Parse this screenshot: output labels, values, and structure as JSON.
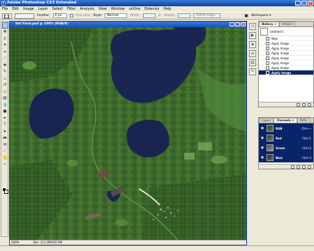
{
  "app": {
    "title": "Adobe Photoshop CS3 Extended",
    "icon": "ps-icon"
  },
  "window_buttons": [
    "_",
    "□",
    "×"
  ],
  "menu": [
    "File",
    "Edit",
    "Image",
    "Layer",
    "Select",
    "Filter",
    "Analysis",
    "View",
    "Window",
    "onOne",
    "Extensis",
    "Help"
  ],
  "options_bar": {
    "feather_label": "Feather:",
    "feather_value": "0 px",
    "antialias_label": "Anti-alias",
    "style_label": "Style:",
    "style_value": "Normal",
    "width_label": "Width:",
    "height_label": "Height:",
    "refine_edge": "Refine Edge...",
    "workspace_label": "Workspace ▾"
  },
  "document": {
    "title": "Sat Final.psd @ 100% (RGB/8)",
    "zoom": "100%",
    "doc_size": "Doc: 111.2M/316.0M"
  },
  "history_panel": {
    "tabs": [
      "History ×",
      "Actions"
    ],
    "snapshot": "Untitled-1",
    "items": [
      "New",
      "Apply Image",
      "Apply Image",
      "Apply Image",
      "Apply Image",
      "Apply Image",
      "Apply Image",
      "Apply Image"
    ],
    "selected_index": 7
  },
  "channels_panel": {
    "tabs": [
      "Layers",
      "Channels ×",
      "Paths"
    ],
    "channels": [
      {
        "name": "RGB",
        "shortcut": "Ctrl+~",
        "selected": true
      },
      {
        "name": "Red",
        "shortcut": "Ctrl+1",
        "selected": true
      },
      {
        "name": "Green",
        "shortcut": "Ctrl+2",
        "selected": true
      },
      {
        "name": "Blue",
        "shortcut": "Ctrl+3",
        "selected": true
      }
    ]
  },
  "colors": {
    "land": "#3f6a2c",
    "water": "#1a2450",
    "selection": "#0a246a",
    "titlebar": "#0a3fa8"
  },
  "icons": {
    "tools": [
      "marquee-icon",
      "move-icon",
      "lasso-icon",
      "magic-wand-icon",
      "crop-icon",
      "slice-icon",
      "healing-icon",
      "brush-icon",
      "stamp-icon",
      "history-brush-icon",
      "eraser-icon",
      "gradient-icon",
      "blur-icon",
      "dodge-icon",
      "pen-icon",
      "type-icon",
      "path-select-icon",
      "shape-icon",
      "notes-icon",
      "eyedropper-icon",
      "hand-icon",
      "zoom-icon"
    ],
    "dock": [
      "history-dock-icon",
      "actions-dock-icon",
      "navigator-dock-icon",
      "layers-dock-icon",
      "channels-dock-icon",
      "paths-dock-icon"
    ]
  }
}
